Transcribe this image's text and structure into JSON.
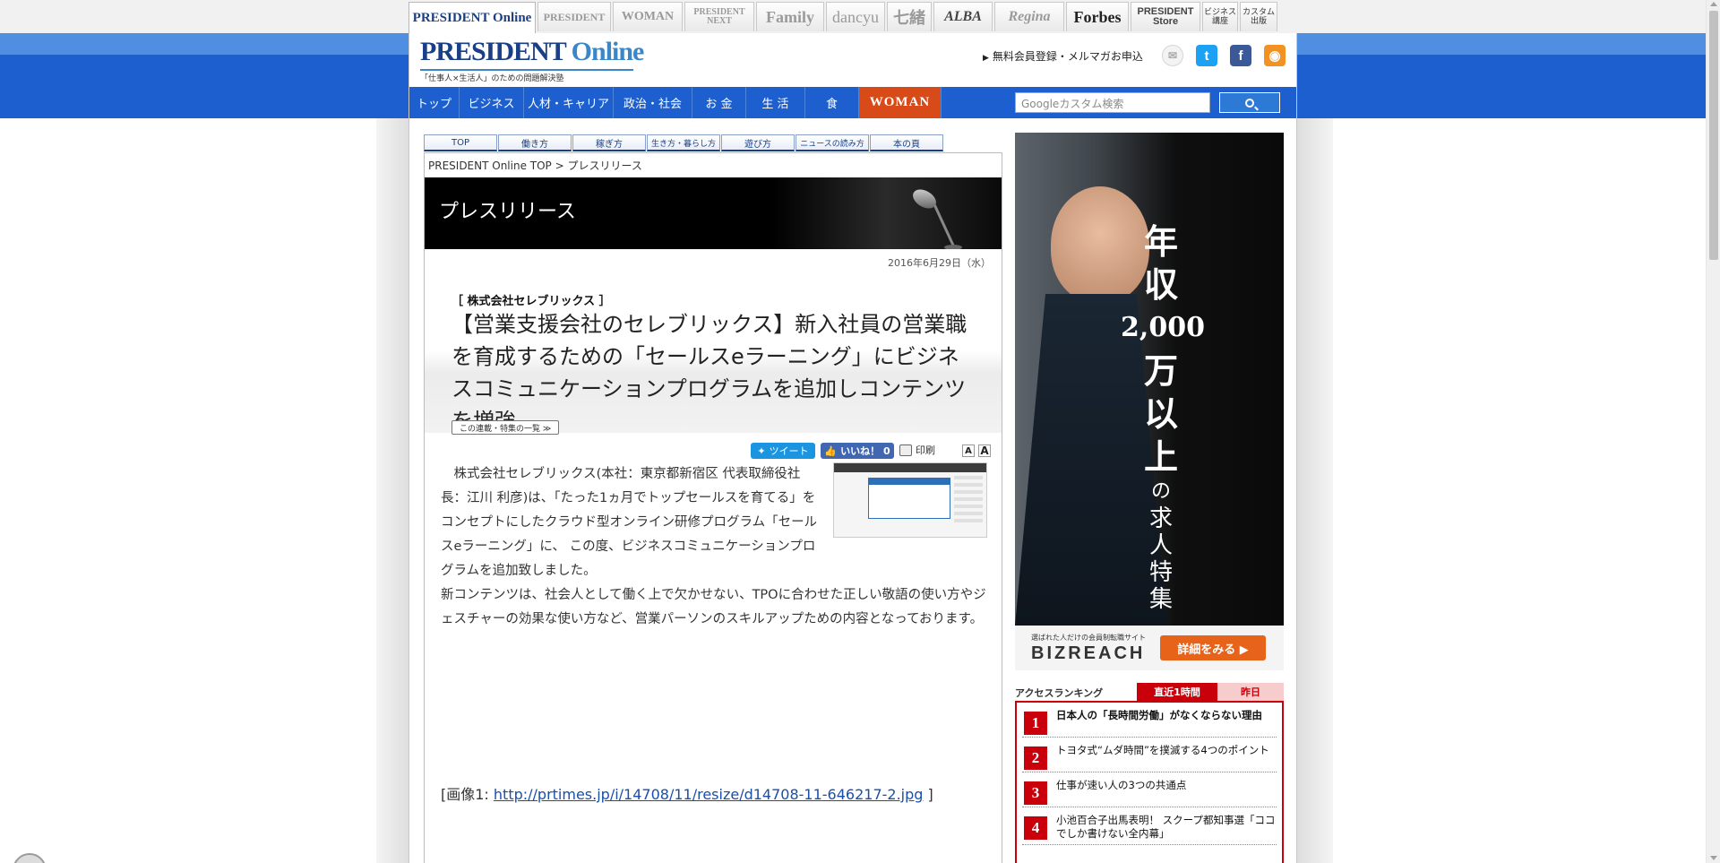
{
  "top_tabs": [
    {
      "label": "PRESIDENT Online",
      "active": true
    },
    {
      "label": "PRESIDENT"
    },
    {
      "label": "WOMAN"
    },
    {
      "label": "PRESIDENT NEXT"
    },
    {
      "label": "Family"
    },
    {
      "label": "dancyu"
    },
    {
      "label": "七緒"
    },
    {
      "label": "ALBA"
    },
    {
      "label": "Regina"
    },
    {
      "label": "Forbes"
    },
    {
      "label": "PRESIDENT Store"
    },
    {
      "label": "ビジネス講座"
    },
    {
      "label": "カスタム出版"
    }
  ],
  "header": {
    "logo_president": "PRESIDENT",
    "logo_online": "Online",
    "tagline": "「仕事人×生活人」のための問題解決塾",
    "signup_link": "無料会員登録・メルマガお申込",
    "icons": [
      "mail-icon",
      "twitter-icon",
      "facebook-icon",
      "rss-icon"
    ]
  },
  "nav": {
    "items": [
      "トップ",
      "ビジネス",
      "人材・キャリア",
      "政治・社会",
      "お 金",
      "生 活",
      "食"
    ],
    "woman": "WOMAN",
    "search_placeholder": "Googleカスタム検索"
  },
  "subnav": [
    "TOP",
    "働き方",
    "稼ぎ方",
    "生き方・暮らし方",
    "遊び方",
    "ニュースの読み方",
    "本の頁"
  ],
  "breadcrumb": "PRESIDENT Online TOP > プレスリリース",
  "section_title": "プレスリリース",
  "article": {
    "date": "2016年6月29日（水）",
    "company": "［ 株式会社セレブリックス ］",
    "headline": "【営業支援会社のセレブリックス】新入社員の営業職を育成するための「セールスeラーニング」にビジネスコミュニケーションプログラムを追加しコンテンツを増強",
    "series_button": "この連載・特集の一覧 ≫",
    "tweet": "ツイート",
    "like": "いいね！ 0",
    "print": "印刷",
    "font_small": "A",
    "font_large": "A",
    "paragraph1": "株式会社セレブリックス(本社：東京都新宿区 代表取締役社長：江川 利彦)は、「たった1ヵ月でトップセールスを育てる」をコンセプトにしたクラウド型オンライン研修プログラム「セールスeラーニング」に、 この度、ビジネスコミュニケーションプログラムを追加致しました。",
    "paragraph2": "新コンテンツは、社会人として働く上で欠かせない、TPOに合わせた正しい敬語の使い方やジェスチャーの効果な使い方など、営業パーソンのスキルアップための内容となっております。",
    "image_prefix": "[画像1: ",
    "image_link": "http://prtimes.jp/i/14708/11/resize/d14708-11-646217-2.jpg",
    "image_suffix": " ]"
  },
  "ad": {
    "headline_1": "年",
    "headline_2": "収",
    "headline_3": "2,000",
    "headline_4": "万",
    "headline_5": "以",
    "headline_6": "上",
    "headline_7": "の",
    "headline_8": "求",
    "headline_9": "人",
    "headline_10": "特",
    "headline_11": "集",
    "brand_small": "選ばれた人だけの会員制転職サイト",
    "brand": "BIZREACH",
    "cta": "詳細をみる ▶"
  },
  "ranking": {
    "title": "アクセスランキング",
    "tab_active": "直近1時間",
    "tab_other": "昨日",
    "items": [
      {
        "num": "1",
        "text": "日本人の「長時間労働」がなくならない理由"
      },
      {
        "num": "2",
        "text": "トヨタ式“ムダ時間”を撲滅する4つのポイント"
      },
      {
        "num": "3",
        "text": "仕事が速い人の3つの共通点"
      },
      {
        "num": "4",
        "text": "小池百合子出馬表明！ スクープ都知事選「ココでしか書けない全内幕」"
      }
    ]
  },
  "colors": {
    "brand_blue": "#1d5fcf",
    "woman_orange": "#d84a18",
    "ranking_red": "#c9000b",
    "ad_cta": "#e8631a"
  }
}
